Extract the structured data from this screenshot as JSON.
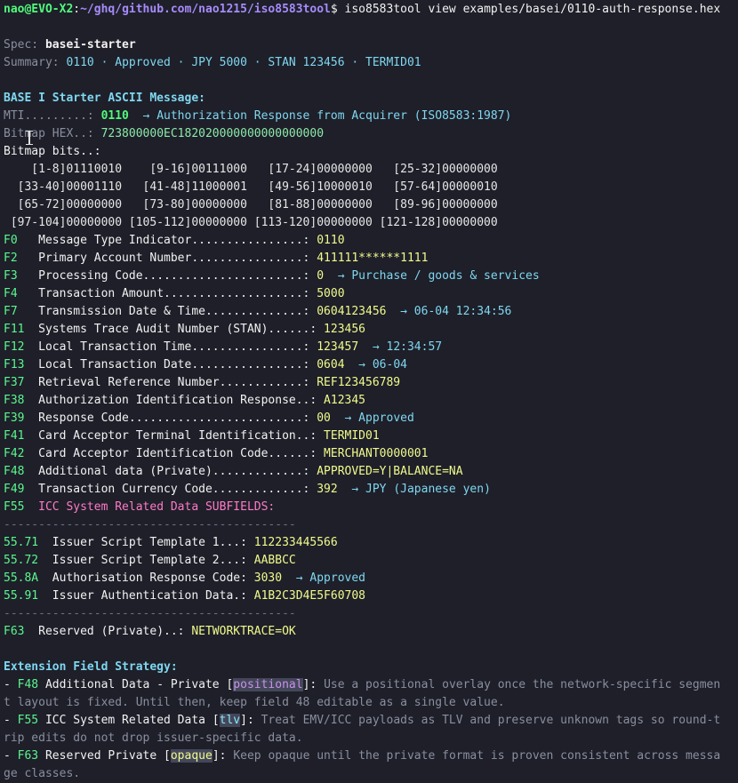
{
  "prompt": {
    "user_host": "nao@EVO-X2",
    "sep": ":",
    "path": "~/ghq/github.com/nao1215/iso8583tool",
    "symbol": "$",
    "command": " iso8583tool view examples/basei/0110-auth-response.hex"
  },
  "spec": {
    "label": "Spec: ",
    "value": "basei-starter"
  },
  "summary": {
    "label": "Summary: ",
    "value": "0110 · Approved · JPY 5000 · STAN 123456 · TERMID01"
  },
  "message_title": "BASE I Starter ASCII Message:",
  "mti": {
    "label": "MTI.........: ",
    "value": "0110",
    "desc": "  → Authorization Response from Acquirer (ISO8583:1987)"
  },
  "bitmap_hex": {
    "label": "Bitmap HEX..: ",
    "value": "723800000EC182020000000000000000"
  },
  "bitmap_bits_label": "Bitmap bits..:",
  "bitmap_rows": [
    "    [1-8]01110010    [9-16]00111000   [17-24]00000000   [25-32]00000000",
    "  [33-40]00001110   [41-48]11000001   [49-56]10000010   [57-64]00000010",
    "  [65-72]00000000   [73-80]00000000   [81-88]00000000   [89-96]00000000",
    " [97-104]00000000 [105-112]00000000 [113-120]00000000 [121-128]00000000"
  ],
  "fields": [
    {
      "id": "F0  ",
      "name": " Message Type Indicator................: ",
      "value": "0110",
      "desc": ""
    },
    {
      "id": "F2  ",
      "name": " Primary Account Number................: ",
      "value": "411111******1111",
      "desc": ""
    },
    {
      "id": "F3  ",
      "name": " Processing Code.......................: ",
      "value": "0",
      "desc": "  → Purchase / goods & services"
    },
    {
      "id": "F4  ",
      "name": " Transaction Amount....................: ",
      "value": "5000",
      "desc": ""
    },
    {
      "id": "F7  ",
      "name": " Transmission Date & Time..............: ",
      "value": "0604123456",
      "desc": "  → 06-04 12:34:56"
    },
    {
      "id": "F11 ",
      "name": " Systems Trace Audit Number (STAN)......: ",
      "value": "123456",
      "desc": ""
    },
    {
      "id": "F12 ",
      "name": " Local Transaction Time................: ",
      "value": "123457",
      "desc": "  → 12:34:57"
    },
    {
      "id": "F13 ",
      "name": " Local Transaction Date................: ",
      "value": "0604",
      "desc": "  → 06-04"
    },
    {
      "id": "F37 ",
      "name": " Retrieval Reference Number............: ",
      "value": "REF123456789",
      "desc": ""
    },
    {
      "id": "F38 ",
      "name": " Authorization Identification Response..: ",
      "value": "A12345",
      "desc": ""
    },
    {
      "id": "F39 ",
      "name": " Response Code.........................: ",
      "value": "00",
      "desc": "  → Approved"
    },
    {
      "id": "F41 ",
      "name": " Card Acceptor Terminal Identification..: ",
      "value": "TERMID01",
      "desc": ""
    },
    {
      "id": "F42 ",
      "name": " Card Acceptor Identification Code......: ",
      "value": "MERCHANT0000001",
      "desc": ""
    },
    {
      "id": "F48 ",
      "name": " Additional data (Private).............: ",
      "value": "APPROVED=Y|BALANCE=NA",
      "desc": ""
    },
    {
      "id": "F49 ",
      "name": " Transaction Currency Code.............: ",
      "value": "392",
      "desc": "  → JPY (Japanese yen)"
    }
  ],
  "f55": {
    "id": "F55 ",
    "title": " ICC System Related Data SUBFIELDS:"
  },
  "separator": "------------------------------------------",
  "subfields": [
    {
      "id": "55.71 ",
      "name": " Issuer Script Template 1...: ",
      "value": "112233445566",
      "desc": ""
    },
    {
      "id": "55.72 ",
      "name": " Issuer Script Template 2...: ",
      "value": "AABBCC",
      "desc": ""
    },
    {
      "id": "55.8A ",
      "name": " Authorisation Response Code: ",
      "value": "3030",
      "desc": "  → Approved"
    },
    {
      "id": "55.91 ",
      "name": " Issuer Authentication Data.: ",
      "value": "A1B2C3D4E5F60708",
      "desc": ""
    }
  ],
  "f63": {
    "id": "F63 ",
    "name": " Reserved (Private)..: ",
    "value": "NETWORKTRACE=OK"
  },
  "strategy_title": "Extension Field Strategy:",
  "strategy": [
    {
      "prefix": "- ",
      "field": "F48",
      "name": " Additional Data - Private ",
      "tag": "positional",
      "lines": [
        "Use a positional overlay once the network-specific segmen",
        "t layout is fixed. Until then, keep field 48 editable as a single value."
      ]
    },
    {
      "prefix": "- ",
      "field": "F55",
      "name": " ICC System Related Data ",
      "tag": "tlv",
      "lines": [
        "Treat EMV/ICC payloads as TLV and preserve unknown tags so round-t",
        "rip edits do not drop issuer-specific data."
      ]
    },
    {
      "prefix": "- ",
      "field": "F63",
      "name": " Reserved Private ",
      "tag": "opaque",
      "lines": [
        "Keep opaque until the private format is proven consistent across messa",
        "ge classes."
      ]
    }
  ]
}
